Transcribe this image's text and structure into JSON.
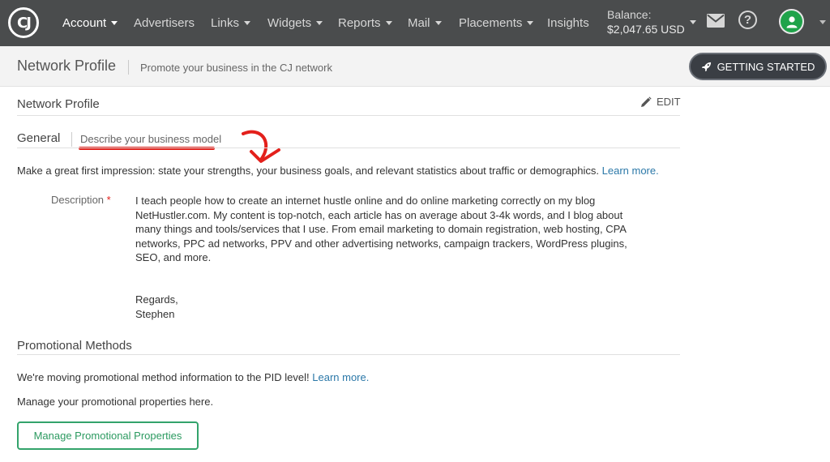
{
  "nav": {
    "logo_text": "CJ",
    "items": [
      {
        "label": "Account",
        "active": true,
        "has_caret": true
      },
      {
        "label": "Advertisers",
        "active": false,
        "has_caret": false
      },
      {
        "label": "Links",
        "active": false,
        "has_caret": true
      },
      {
        "label": "Widgets",
        "active": false,
        "has_caret": true
      },
      {
        "label": "Reports",
        "active": false,
        "has_caret": true
      },
      {
        "label": "Mail",
        "active": false,
        "has_caret": true
      },
      {
        "label": "Placements",
        "active": false,
        "has_caret": true
      },
      {
        "label": "Insights",
        "active": false,
        "has_caret": false
      }
    ],
    "balance_label": "Balance:",
    "balance_amount": "$2,047.65 USD",
    "icons": [
      "mail-icon",
      "help-icon",
      "user-avatar-icon"
    ]
  },
  "subheader": {
    "title": "Network Profile",
    "subtitle": "Promote your business in the CJ network",
    "getting_started": "GETTING STARTED"
  },
  "profile": {
    "section_title": "Network Profile",
    "edit_label": "EDIT",
    "general": {
      "tab_label": "General",
      "tab_desc": "Describe your business model",
      "intro": "Make a great first impression: state your strengths, your business goals, and relevant statistics about traffic or demographics.",
      "intro_link": "Learn more.",
      "description_label": "Description",
      "required_mark": "*",
      "description_text": "I teach people how to create an internet hustle online and do online marketing correctly on my blog NetHustler.com.  My content is top-notch, each article has on average about 3-4k words, and I blog about many things and tools/services that I use. From email marketing to domain registration, web hosting, CPA networks, PPC ad networks, PPV and other advertising networks, campaign trackers, WordPress plugins, SEO, and more.",
      "regards_line1": "Regards,",
      "regards_line2": "Stephen"
    },
    "promotional": {
      "title": "Promotional Methods",
      "notice": "We're moving promotional method information to the PID level!",
      "notice_link": "Learn more.",
      "manage_text": "Manage your promotional properties here.",
      "manage_button": "Manage Promotional Properties"
    }
  },
  "colors": {
    "nav_bg": "#4a4c4d",
    "link": "#2b78a8",
    "annotation_red": "#e3201b",
    "button_green": "#33a36b",
    "avatar_green": "#1fa34a"
  }
}
